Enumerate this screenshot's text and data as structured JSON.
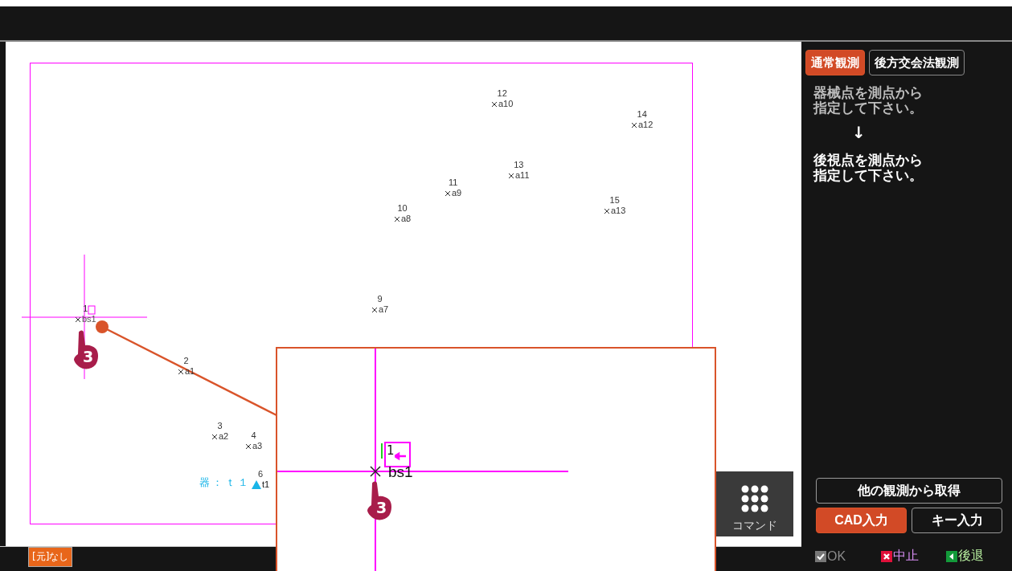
{
  "canvas": {
    "points": [
      {
        "number": "1",
        "name": "bs1",
        "kind": "backsight"
      },
      {
        "number": "2",
        "name": "a1",
        "kind": "survey"
      },
      {
        "number": "3",
        "name": "a2",
        "kind": "survey"
      },
      {
        "number": "4",
        "name": "a3",
        "kind": "survey"
      },
      {
        "number": "6",
        "name": "t1",
        "kind": "instrument"
      },
      {
        "number": "9",
        "name": "a7",
        "kind": "survey"
      },
      {
        "number": "10",
        "name": "a8",
        "kind": "survey"
      },
      {
        "number": "11",
        "name": "a9",
        "kind": "survey"
      },
      {
        "number": "12",
        "name": "a10",
        "kind": "survey"
      },
      {
        "number": "13",
        "name": "a11",
        "kind": "survey"
      },
      {
        "number": "14",
        "name": "a12",
        "kind": "survey"
      },
      {
        "number": "15",
        "name": "a13",
        "kind": "survey"
      }
    ],
    "instrument_label": "器：ｔ１"
  },
  "zoom_view": {
    "point_number": "1",
    "point_name": "bs1"
  },
  "step_markers": [
    {
      "number": "3"
    },
    {
      "number": "3"
    }
  ],
  "command_button": {
    "label": "コマンド"
  },
  "status_bar": {
    "source_badge": "[元]なし"
  },
  "panel": {
    "tabs": [
      {
        "label": "通常観測",
        "selected": true
      },
      {
        "label": "後方交会法観測",
        "selected": false
      }
    ],
    "instructions": [
      {
        "lines": [
          "器械点を測点から",
          "指定して下さい。"
        ],
        "active": false
      },
      {
        "lines": [
          "後視点を測点から",
          "指定して下さい。"
        ],
        "active": true
      }
    ],
    "arrow": "↓",
    "buttons": [
      {
        "label": "他の観測から取得",
        "selected": false
      },
      {
        "label": "CAD入力",
        "selected": true
      },
      {
        "label": "キー入力",
        "selected": false
      }
    ],
    "footer": [
      {
        "kind": "ok",
        "label": "OK",
        "disabled": true
      },
      {
        "kind": "cancel",
        "label": "中止",
        "disabled": false
      },
      {
        "kind": "back",
        "label": "後退",
        "disabled": false
      }
    ]
  }
}
